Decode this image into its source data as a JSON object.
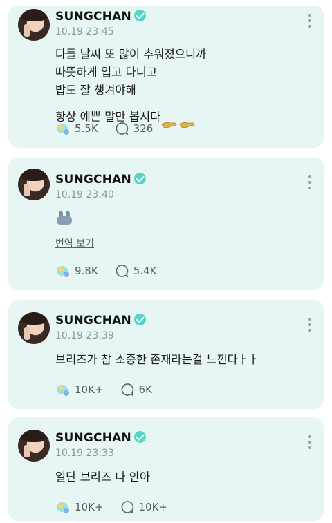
{
  "posts": [
    {
      "author": "SUNGCHAN",
      "time": "10.19 23:45",
      "text": "다들 날씨 또 많이 추워졌으니까\n따뜻하게 입고 다니고\n밥도 잘 챙겨야해\n항상 예쁜 말만 봅시다",
      "likes": "5.5K",
      "comments": "326"
    },
    {
      "author": "SUNGCHAN",
      "time": "10.19 23:40",
      "translate_label": "번역 보기",
      "likes": "9.8K",
      "comments": "5.4K"
    },
    {
      "author": "SUNGCHAN",
      "time": "10.19 23:39",
      "text": "브리즈가 참 소중한 존재라는걸 느낀다ㅏㅏ",
      "likes": "10K+",
      "comments": "6K"
    },
    {
      "author": "SUNGCHAN",
      "time": "10.19 23:33",
      "text": "일단 브리즈 나 안아",
      "likes": "10K+",
      "comments": "10K+"
    }
  ],
  "icons": {
    "verified": "verified-badge-icon",
    "like": "bubble-heart-icon",
    "comment": "comment-bubble-icon",
    "more": "more-vertical-icon",
    "emoji": "pointing-hands-emoji",
    "sticker": "bunny-sticker"
  },
  "colors": {
    "card_background": "#e7f6f5",
    "verified": "#54d6c4",
    "muted_text": "#8a9896"
  }
}
